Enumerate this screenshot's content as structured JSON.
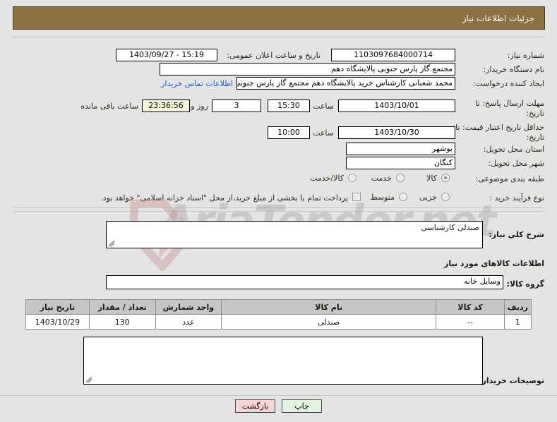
{
  "header": {
    "title": "جزئیات اطلاعات نیاز"
  },
  "watermark": {
    "text": "AriaTender.net"
  },
  "form": {
    "need_number": {
      "label": "شماره نیاز:",
      "value": "1103097684000714"
    },
    "announce_datetime": {
      "label": "تاریخ و ساعت اعلان عمومی:",
      "value": "15:19 - 1403/09/27"
    },
    "buyer_org": {
      "label": "نام دستگاه خریدار:",
      "value": "مجتمع گاز پارس جنوبی  پالایشگاه دهم"
    },
    "request_creator": {
      "label": "ایجاد کننده درخواست:",
      "value": "محمد شعبانی کارشناس خرید پالایشگاه دهم  مجتمع گاز پارس جنوبی  پالایشگُ"
    },
    "contact_link": "اطلاعات تماس خریدار",
    "response_deadline": {
      "label": "مهلت ارسال پاسخ: تا تاریخ:",
      "date": "1403/10/01",
      "hour_label": "ساعت",
      "hour": "15:30",
      "days": "3",
      "days_label": "روز و",
      "countdown": "23:36:56",
      "countdown_label": "ساعت باقی مانده"
    },
    "price_validity": {
      "label": "حداقل تاریخ اعتبار قیمت: تا تاریخ:",
      "date": "1403/10/30",
      "hour_label": "ساعت",
      "hour": "10:00"
    },
    "delivery_province": {
      "label": "استان محل تحویل:",
      "value": "بوشهر"
    },
    "delivery_city": {
      "label": "شهر محل تحویل:",
      "value": "کنگان"
    },
    "subject_class": {
      "label": "طبقه بندی موضوعی:",
      "options": [
        "کالا",
        "خدمت",
        "کالا/خدمت"
      ],
      "selected": 0
    },
    "purchase_type": {
      "label": "نوع فرآیند خرید :",
      "options": [
        "جزیی",
        "متوسط"
      ],
      "selected": -1
    },
    "treasury_note": {
      "checked": false,
      "text": "پرداخت تمام یا بخشی از مبلغ خرید،از محل \"اسناد خزانه اسلامی\" خواهد بود."
    },
    "general_description": {
      "label": "شرح کلی نیاز:",
      "value": "صندلی کارشناسی"
    },
    "goods_section_title": "اطلاعات کالاهای مورد نیاز",
    "goods_group": {
      "label": "گروه کالا:",
      "value": "وسایل خانه"
    },
    "buyer_comments": {
      "label": "توضیحات خریدار:",
      "value": ""
    }
  },
  "goods_table": {
    "columns": [
      "ردیف",
      "کد کالا",
      "نام کالا",
      "واحد شمارش",
      "تعداد / مقدار",
      "تاریخ نیاز"
    ],
    "rows": [
      {
        "row": "1",
        "code": "--",
        "name": "صندلی",
        "unit": "عدد",
        "qty": "130",
        "need_date": "1403/10/29"
      }
    ]
  },
  "footer": {
    "print_label": "چاپ",
    "back_label": "بازگشت"
  },
  "colors": {
    "titlebar": "#8c7143",
    "link": "#1a5fd0",
    "table_header": "#c6c6c6",
    "print_btn": "#e2f3e2",
    "back_btn": "#f7d4d4",
    "countdown_bg": "#f6f3d8"
  }
}
